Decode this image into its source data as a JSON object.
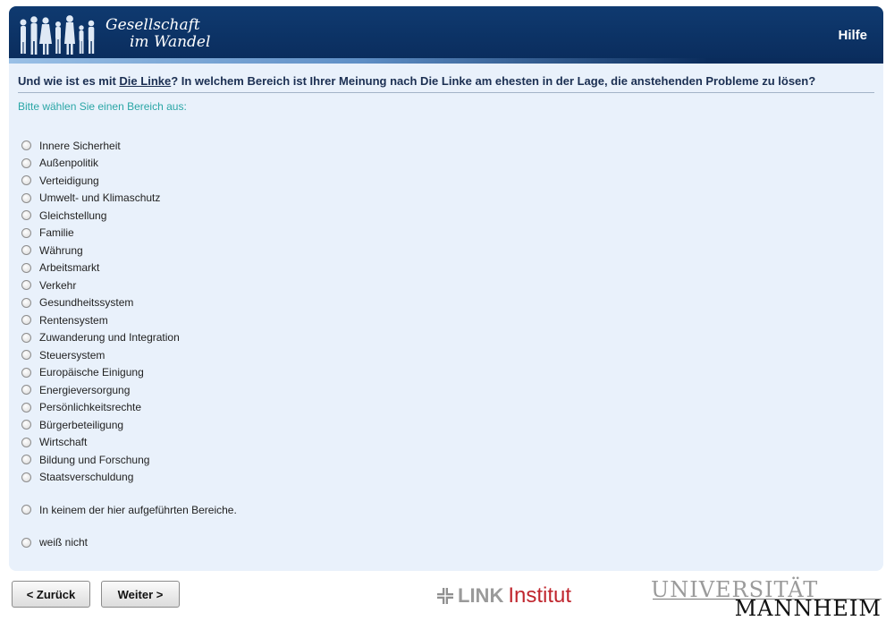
{
  "header": {
    "logo_line1": "Gesellschaft",
    "logo_line2": "im Wandel",
    "help_label": "Hilfe",
    "bg_color": "#0a2c5c"
  },
  "question": {
    "prefix": "Und wie ist es mit ",
    "party": "Die Linke",
    "suffix": "? In welchem Bereich ist Ihrer Meinung nach Die Linke am ehesten in der Lage, die anstehenden Probleme zu lösen?"
  },
  "instruction": "Bitte wählen Sie einen Bereich aus:",
  "options": [
    {
      "label": "Innere Sicherheit",
      "selected": false
    },
    {
      "label": "Außenpolitik",
      "selected": false
    },
    {
      "label": "Verteidigung",
      "selected": false
    },
    {
      "label": "Umwelt- und Klimaschutz",
      "selected": false
    },
    {
      "label": "Gleichstellung",
      "selected": false
    },
    {
      "label": "Familie",
      "selected": false
    },
    {
      "label": "Währung",
      "selected": false
    },
    {
      "label": "Arbeitsmarkt",
      "selected": false
    },
    {
      "label": "Verkehr",
      "selected": false
    },
    {
      "label": "Gesundheitssystem",
      "selected": false
    },
    {
      "label": "Rentensystem",
      "selected": false
    },
    {
      "label": "Zuwanderung und Integration",
      "selected": false
    },
    {
      "label": "Steuersystem",
      "selected": false
    },
    {
      "label": "Europäische Einigung",
      "selected": false
    },
    {
      "label": "Energieversorgung",
      "selected": false
    },
    {
      "label": "Persönlichkeitsrechte",
      "selected": false
    },
    {
      "label": "Bürgerbeteiligung",
      "selected": false
    },
    {
      "label": "Wirtschaft",
      "selected": false
    },
    {
      "label": "Bildung und Forschung",
      "selected": false
    },
    {
      "label": "Staatsverschuldung",
      "selected": false
    }
  ],
  "option_none": {
    "label": "In keinem der hier aufgeführten Bereiche.",
    "selected": false
  },
  "option_dontknow": {
    "label": "weiß nicht",
    "selected": false
  },
  "nav": {
    "back_label": "< Zurück",
    "next_label": "Weiter >"
  },
  "footer": {
    "link_word": "LINK",
    "institut_word": "Institut",
    "uni_line1": "UNIVERSITÄT",
    "uni_line2": "MANNHEIM",
    "link_red": "#c0262e"
  }
}
